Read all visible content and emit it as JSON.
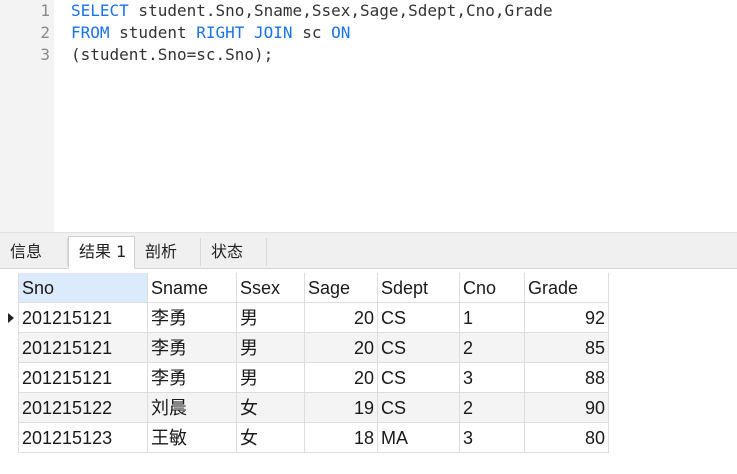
{
  "editor": {
    "line_numbers": [
      "1",
      "2",
      "3"
    ],
    "lines": [
      [
        {
          "t": "SELECT",
          "kw": true
        },
        {
          "t": " student.Sno,Sname,Ssex,Sage,Sdept,Cno,Grade",
          "kw": false
        }
      ],
      [
        {
          "t": "FROM",
          "kw": true
        },
        {
          "t": " student ",
          "kw": false
        },
        {
          "t": "RIGHT JOIN",
          "kw": true
        },
        {
          "t": " sc ",
          "kw": false
        },
        {
          "t": "ON",
          "kw": true
        }
      ],
      [
        {
          "t": "(student.Sno=sc.Sno);",
          "kw": false
        }
      ]
    ]
  },
  "tabs": [
    {
      "label": "信息",
      "active": false
    },
    {
      "label": "结果 1",
      "active": true
    },
    {
      "label": "剖析",
      "active": false
    },
    {
      "label": "状态",
      "active": false
    }
  ],
  "result": {
    "columns": [
      "Sno",
      "Sname",
      "Ssex",
      "Sage",
      "Sdept",
      "Cno",
      "Grade"
    ],
    "numeric_columns": [
      3,
      6
    ],
    "selected_header": 0,
    "current_row": 0,
    "rows": [
      [
        "201215121",
        "李勇",
        "男",
        "20",
        "CS",
        "1",
        "92"
      ],
      [
        "201215121",
        "李勇",
        "男",
        "20",
        "CS",
        "2",
        "85"
      ],
      [
        "201215121",
        "李勇",
        "男",
        "20",
        "CS",
        "3",
        "88"
      ],
      [
        "201215122",
        "刘晨",
        "女",
        "19",
        "CS",
        "2",
        "90"
      ],
      [
        "201215123",
        "王敏",
        "女",
        "18",
        "MA",
        "3",
        "80"
      ]
    ]
  }
}
